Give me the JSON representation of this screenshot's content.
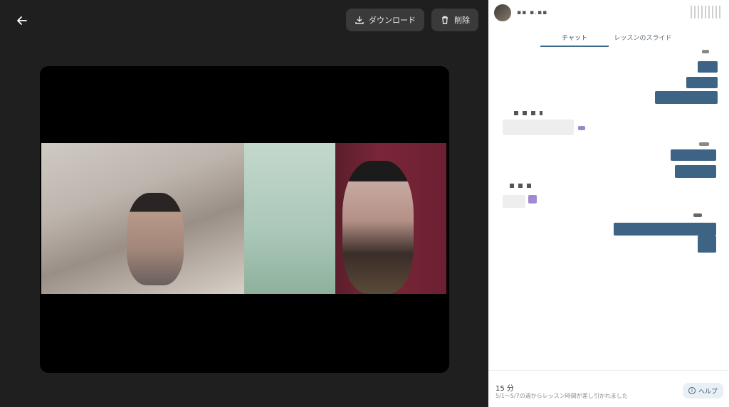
{
  "toolbar": {
    "download_label": "ダウンロード",
    "delete_label": "削除"
  },
  "tabs": [
    {
      "label": "チャット",
      "active": true
    },
    {
      "label": "レッスンのスライド",
      "active": false
    }
  ],
  "footer": {
    "duration": "15 分",
    "note": "5/1〜5/7の週からレッスン時間が差し引かれました",
    "help_label": "ヘルプ"
  },
  "colors": {
    "viewer_bg": "#1f1f1f",
    "outgoing_bubble": "#3d6485",
    "incoming_bubble": "#eeeeee",
    "tab_accent": "#3b6a8c"
  }
}
